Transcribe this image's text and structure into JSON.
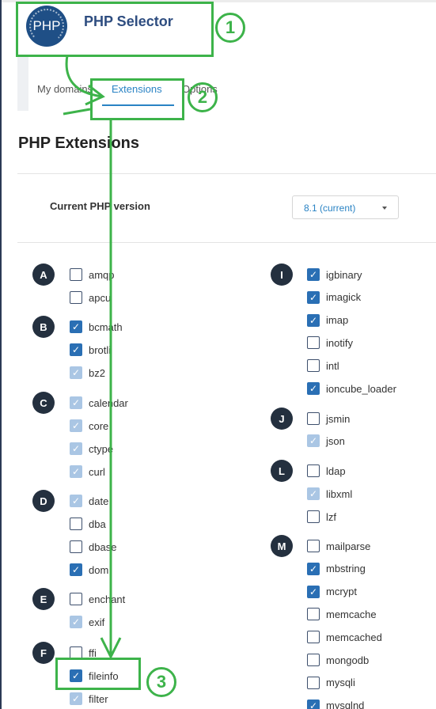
{
  "app": {
    "title": "PHP Selector",
    "logo_text": "PHP",
    "logo_icon": "php-logo-icon"
  },
  "tabs": [
    {
      "label": "My domains",
      "active": false
    },
    {
      "label": "Extensions",
      "active": true
    },
    {
      "label": "Options",
      "active": false
    }
  ],
  "section_title": "PHP Extensions",
  "php_version": {
    "label": "Current PHP version",
    "selected": "8.1 (current)"
  },
  "extension_groups": {
    "left": [
      {
        "letter": "A",
        "items": [
          {
            "name": "amqp",
            "state": "unchecked"
          },
          {
            "name": "apcu",
            "state": "unchecked"
          }
        ]
      },
      {
        "letter": "B",
        "items": [
          {
            "name": "bcmath",
            "state": "checked"
          },
          {
            "name": "brotli",
            "state": "checked"
          },
          {
            "name": "bz2",
            "state": "default"
          }
        ]
      },
      {
        "letter": "C",
        "items": [
          {
            "name": "calendar",
            "state": "default"
          },
          {
            "name": "core",
            "state": "default"
          },
          {
            "name": "ctype",
            "state": "default"
          },
          {
            "name": "curl",
            "state": "default"
          }
        ]
      },
      {
        "letter": "D",
        "items": [
          {
            "name": "date",
            "state": "default"
          },
          {
            "name": "dba",
            "state": "unchecked"
          },
          {
            "name": "dbase",
            "state": "unchecked"
          },
          {
            "name": "dom",
            "state": "checked"
          }
        ]
      },
      {
        "letter": "E",
        "items": [
          {
            "name": "enchant",
            "state": "unchecked"
          },
          {
            "name": "exif",
            "state": "default"
          }
        ]
      },
      {
        "letter": "F",
        "items": [
          {
            "name": "ffi",
            "state": "unchecked"
          },
          {
            "name": "fileinfo",
            "state": "checked"
          },
          {
            "name": "filter",
            "state": "default"
          }
        ]
      }
    ],
    "right": [
      {
        "letter": "I",
        "items": [
          {
            "name": "igbinary",
            "state": "checked"
          },
          {
            "name": "imagick",
            "state": "checked"
          },
          {
            "name": "imap",
            "state": "checked"
          },
          {
            "name": "inotify",
            "state": "unchecked"
          },
          {
            "name": "intl",
            "state": "unchecked"
          },
          {
            "name": "ioncube_loader",
            "state": "checked"
          }
        ]
      },
      {
        "letter": "J",
        "items": [
          {
            "name": "jsmin",
            "state": "unchecked"
          },
          {
            "name": "json",
            "state": "default"
          }
        ]
      },
      {
        "letter": "L",
        "items": [
          {
            "name": "ldap",
            "state": "unchecked"
          },
          {
            "name": "libxml",
            "state": "default"
          },
          {
            "name": "lzf",
            "state": "unchecked"
          }
        ]
      },
      {
        "letter": "M",
        "items": [
          {
            "name": "mailparse",
            "state": "unchecked"
          },
          {
            "name": "mbstring",
            "state": "checked"
          },
          {
            "name": "mcrypt",
            "state": "checked"
          },
          {
            "name": "memcache",
            "state": "unchecked"
          },
          {
            "name": "memcached",
            "state": "unchecked"
          },
          {
            "name": "mongodb",
            "state": "unchecked"
          },
          {
            "name": "mysqli",
            "state": "unchecked"
          },
          {
            "name": "mysqlnd",
            "state": "checked"
          }
        ]
      }
    ]
  },
  "annotations": [
    {
      "number": "1",
      "target": "PHP Selector"
    },
    {
      "number": "2",
      "target": "Extensions"
    },
    {
      "number": "3",
      "target": "fileinfo"
    }
  ],
  "colors": {
    "annotation": "#3db34a",
    "accent": "#2a83c4",
    "checked": "#2a6fb4",
    "default_checked": "#aac6e4",
    "letter_badge": "#24303f"
  },
  "icons": {
    "check": "✓",
    "caret": "caret-down-icon"
  }
}
